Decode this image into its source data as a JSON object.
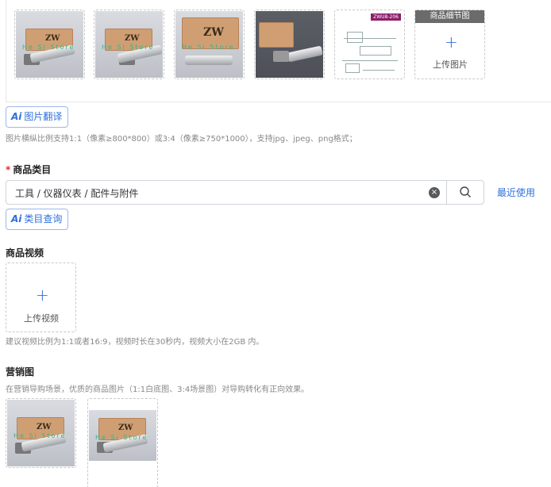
{
  "images": {
    "thumbnails": [
      {
        "kind": "photo",
        "watermark": "He  Si  Store"
      },
      {
        "kind": "photo",
        "watermark": "He  Si  Store"
      },
      {
        "kind": "photo",
        "watermark": "He  Si  Store"
      },
      {
        "kind": "photo-dark",
        "watermark": "He  Si  Store"
      },
      {
        "kind": "drawing",
        "tag": "ZWU8-206"
      }
    ],
    "box_logo": "ZW",
    "detail_header": "商品细节图",
    "detail_plus": "+",
    "detail_upload_label": "上传图片",
    "ai_translate_prefix": "Ai",
    "ai_translate_label": "图片翻译",
    "hint": "图片横纵比例支持1:1（像素≥800*800）或3:4（像素≥750*1000），支持jpg、jpeg、png格式；"
  },
  "category": {
    "required_mark": "*",
    "title": "商品类目",
    "value": "工具 / 仪器仪表 / 配件与附件",
    "clear_symbol": "×",
    "recent_label": "最近使用",
    "ai_query_prefix": "Ai",
    "ai_query_label": "类目查询"
  },
  "video": {
    "title": "商品视频",
    "plus": "+",
    "upload_label": "上传视频",
    "hint": "建议视频比例为1:1或者16:9，视频时长在30秒内，视频大小在2GB 内。"
  },
  "marketing": {
    "title": "营销图",
    "hint": "在营销导购场景，优质的商品图片（1:1白底图、3:4场景图）对导购转化有正向效果。"
  },
  "colors": {
    "accent": "#2f6fdc",
    "required": "#e02d2d",
    "hint": "#888888"
  }
}
